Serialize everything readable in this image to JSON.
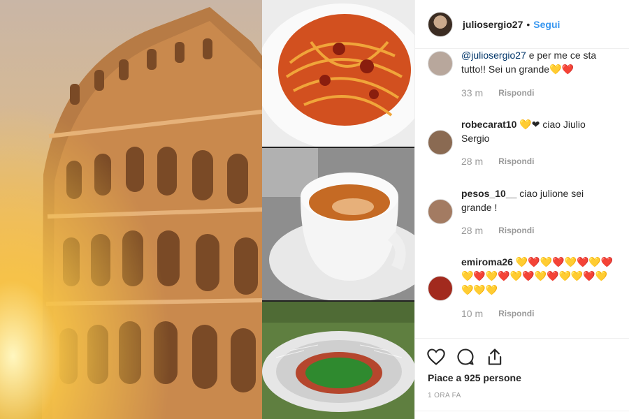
{
  "post": {
    "username": "juliosergio27",
    "separator": "•",
    "follow_label": "Segui"
  },
  "comments": [
    {
      "user": "",
      "mention": "@juliosergio27",
      "text": " e per me ce sta tutto!! Sei un grande💛❤️",
      "time": "33 m",
      "reply": "Rispondi"
    },
    {
      "user": "robecarat10",
      "mention": "",
      "text": " 💛❤ ciao Jiulio Sergio",
      "time": "28 m",
      "reply": "Rispondi"
    },
    {
      "user": "pesos_10__",
      "mention": "",
      "text": " ciao julione sei grande !",
      "time": "28 m",
      "reply": "Rispondi"
    },
    {
      "user": "emiroma26",
      "mention": "",
      "text": " 💛❤️💛❤️💛❤️💛❤️💛❤️💛❤️💛❤️💛❤️💛💛❤️💛💛💛💛",
      "time": "10 m",
      "reply": "Rispondi"
    }
  ],
  "footer": {
    "likes": "Piace a 925 persone",
    "age": "1 ORA FA"
  },
  "icons": [
    "heart-icon",
    "comment-icon",
    "share-icon"
  ]
}
